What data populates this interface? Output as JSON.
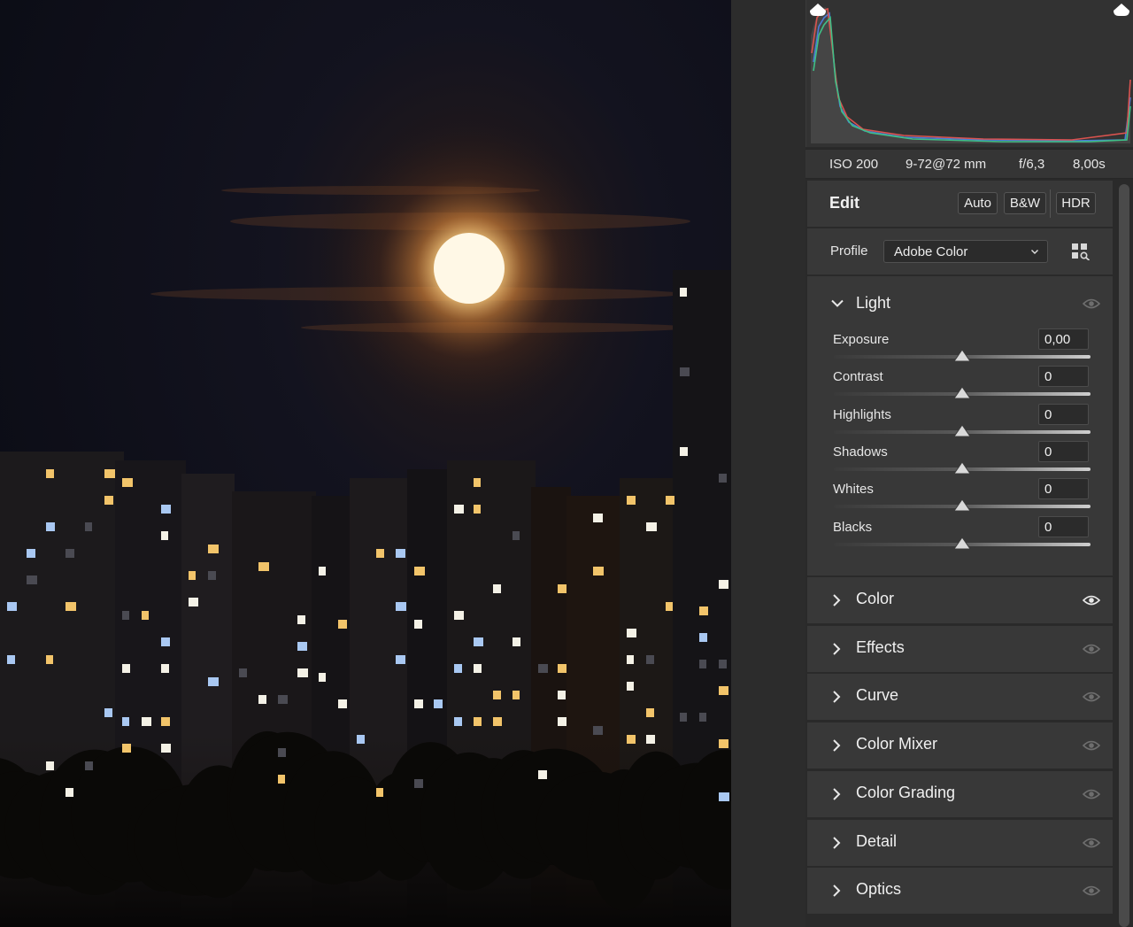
{
  "exif": {
    "iso": "ISO 200",
    "lens": "9-72@72 mm",
    "aperture": "f/6,3",
    "shutter": "8,00s"
  },
  "edit": {
    "title": "Edit",
    "auto_label": "Auto",
    "bw_label": "B&W",
    "hdr_label": "HDR",
    "profile_label": "Profile",
    "profile_value": "Adobe Color"
  },
  "light": {
    "title": "Light",
    "sliders": [
      {
        "label": "Exposure",
        "value": "0,00",
        "position": 0.5
      },
      {
        "label": "Contrast",
        "value": "0",
        "position": 0.5
      },
      {
        "label": "Highlights",
        "value": "0",
        "position": 0.5
      },
      {
        "label": "Shadows",
        "value": "0",
        "position": 0.5
      },
      {
        "label": "Whites",
        "value": "0",
        "position": 0.5
      },
      {
        "label": "Blacks",
        "value": "0",
        "position": 0.5
      }
    ]
  },
  "sections": [
    {
      "title": "Color",
      "eye_active": true
    },
    {
      "title": "Effects",
      "eye_active": false
    },
    {
      "title": "Curve",
      "eye_active": false
    },
    {
      "title": "Color Mixer",
      "eye_active": false
    },
    {
      "title": "Color Grading",
      "eye_active": false
    },
    {
      "title": "Detail",
      "eye_active": false
    },
    {
      "title": "Optics",
      "eye_active": false
    }
  ],
  "icons": {
    "chevron_down": "chevron-down-icon",
    "chevron_right": "chevron-right-icon",
    "eye": "eye-icon",
    "profile_browser": "profile-browser-icon",
    "clipping_warning": "clipping-warning-icon"
  },
  "colors": {
    "panel_bg": "#2a2a2a",
    "section_bg": "#383838",
    "text": "#e8e8e8",
    "eye_active": "#e8e8e8",
    "eye_inactive": "#6e6e6e"
  }
}
